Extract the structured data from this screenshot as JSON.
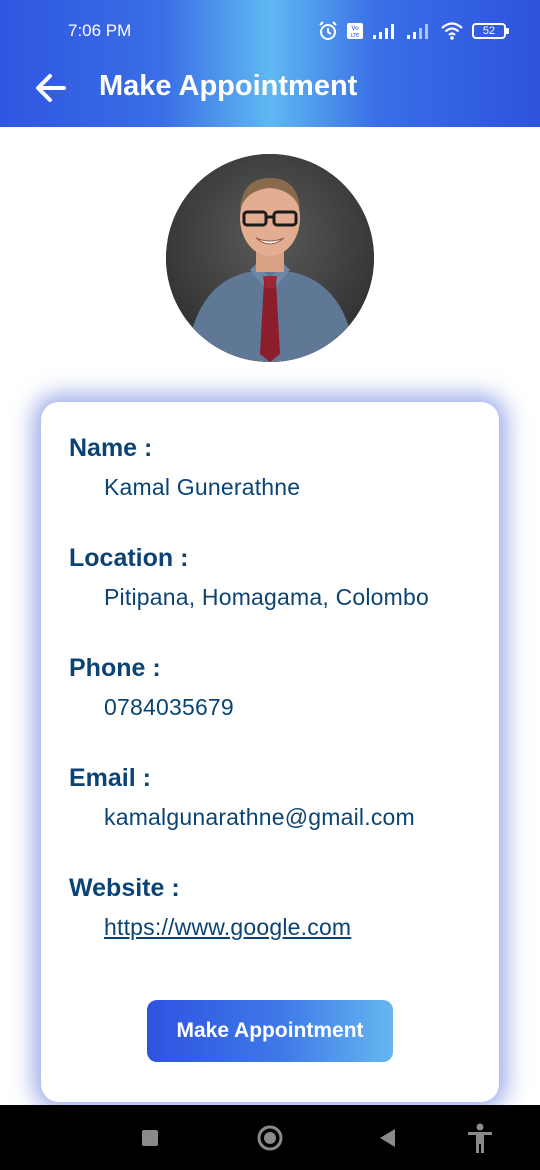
{
  "status_bar": {
    "time": "7:06 PM",
    "battery": "52"
  },
  "header": {
    "title": "Make Appointment"
  },
  "profile": {
    "fields": [
      {
        "label": "Name :",
        "value": "Kamal Gunerathne"
      },
      {
        "label": "Location :",
        "value": "Pitipana, Homagama, Colombo"
      },
      {
        "label": "Phone :",
        "value": "0784035679"
      },
      {
        "label": "Email :",
        "value": "kamalgunarathne@gmail.com"
      },
      {
        "label": "Website :",
        "value": "https://www.google.com"
      }
    ]
  },
  "actions": {
    "make_appointment_label": "Make Appointment"
  },
  "icons": {
    "back": "arrow-left-icon",
    "alarm": "alarm-icon",
    "volte": "volte-icon",
    "signal": "signal-icon",
    "wifi": "wifi-icon",
    "battery": "battery-icon",
    "nav_recent": "square-icon",
    "nav_home": "circle-icon",
    "nav_back": "triangle-back-icon",
    "accessibility": "accessibility-icon"
  },
  "colors": {
    "primary": "#2f56e0",
    "text_dark_blue": "#0b4474",
    "card_shadow": "#506ed7"
  }
}
